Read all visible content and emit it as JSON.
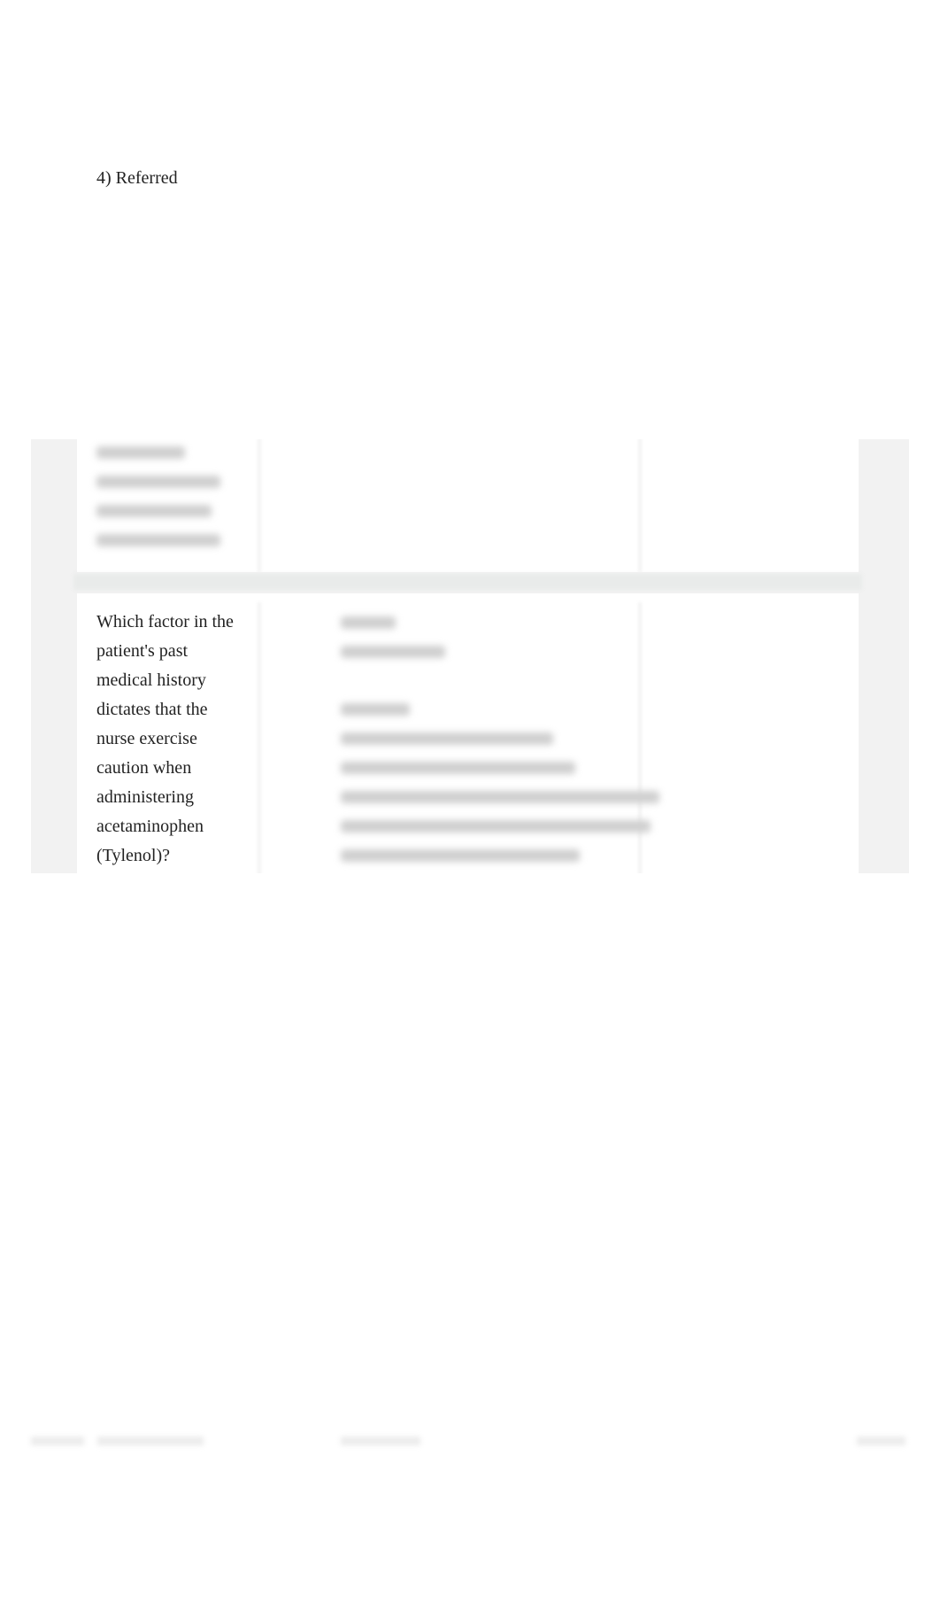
{
  "previous_answer": {
    "text": "4) Referred"
  },
  "question_card": {
    "question": "Which factor in the patient's past medical history dictates that the nurse exercise caution when administering acetaminophen (Tylenol)?"
  },
  "colors": {
    "panel_background": "#f2f2f2",
    "card_background": "#ffffff",
    "text": "#222222"
  }
}
